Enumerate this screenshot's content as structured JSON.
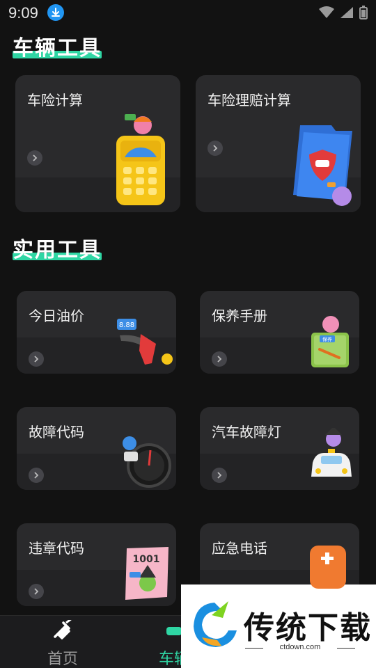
{
  "status_bar": {
    "time": "9:09"
  },
  "sections": {
    "vehicle_tools_title": "车辆工具",
    "practical_tools_title": "实用工具"
  },
  "vehicle_cards": [
    {
      "label": "车险计算"
    },
    {
      "label": "车险理赔计算"
    }
  ],
  "practical_cards": [
    {
      "label": "今日油价",
      "tag": "8.88"
    },
    {
      "label": "保养手册",
      "tag": "保养"
    },
    {
      "label": "故障代码"
    },
    {
      "label": "汽车故障灯"
    },
    {
      "label": "违章代码",
      "tag": "1001"
    },
    {
      "label": "应急电话"
    }
  ],
  "tab_bar": {
    "home_label": "首页",
    "vehicle_label": "车辆"
  },
  "watermark": {
    "title": "传统下载",
    "url": "ctdown.com"
  },
  "colors": {
    "accent": "#2fd6a4",
    "background": "#121212",
    "card": "#2a2a2c"
  }
}
